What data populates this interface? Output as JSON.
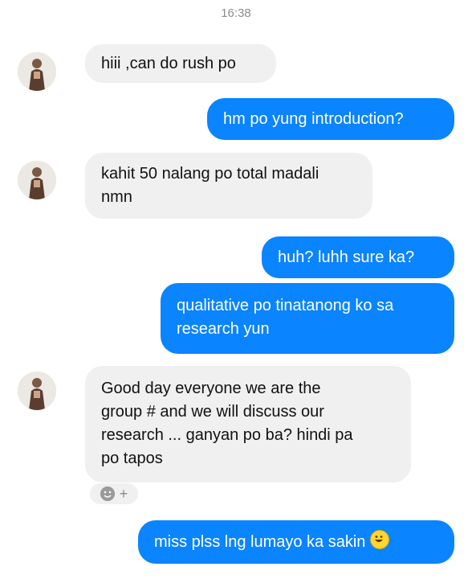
{
  "header": {
    "time": "16:38"
  },
  "messages": [
    {
      "side": "in",
      "text": "hiii ,can do rush po"
    },
    {
      "side": "out",
      "text": "hm po yung introduction?"
    },
    {
      "side": "in",
      "text_line1": "kahit 50 nalang po total madali",
      "text_line2": "nmn"
    },
    {
      "side": "out",
      "text": "huh? luhh sure ka?"
    },
    {
      "side": "out",
      "text_line1": "qualitative po tinatanong ko sa",
      "text_line2": "research yun"
    },
    {
      "side": "in",
      "text_line1": "Good day everyone we are the",
      "text_line2": "group # and we will discuss our",
      "text_line3": "research ... ganyan po ba? hindi pa",
      "text_line4": "po tapos"
    },
    {
      "side": "out",
      "text": "miss plss lng lumayo ka sakin",
      "emoji": "grinning-face-emoji"
    }
  ],
  "reaction": {
    "plus": "+",
    "icon": "add-reaction-smiley-icon"
  },
  "colors": {
    "outgoing": "#0a84ff",
    "incoming": "#f0f0f0",
    "time": "#8a8d91"
  }
}
